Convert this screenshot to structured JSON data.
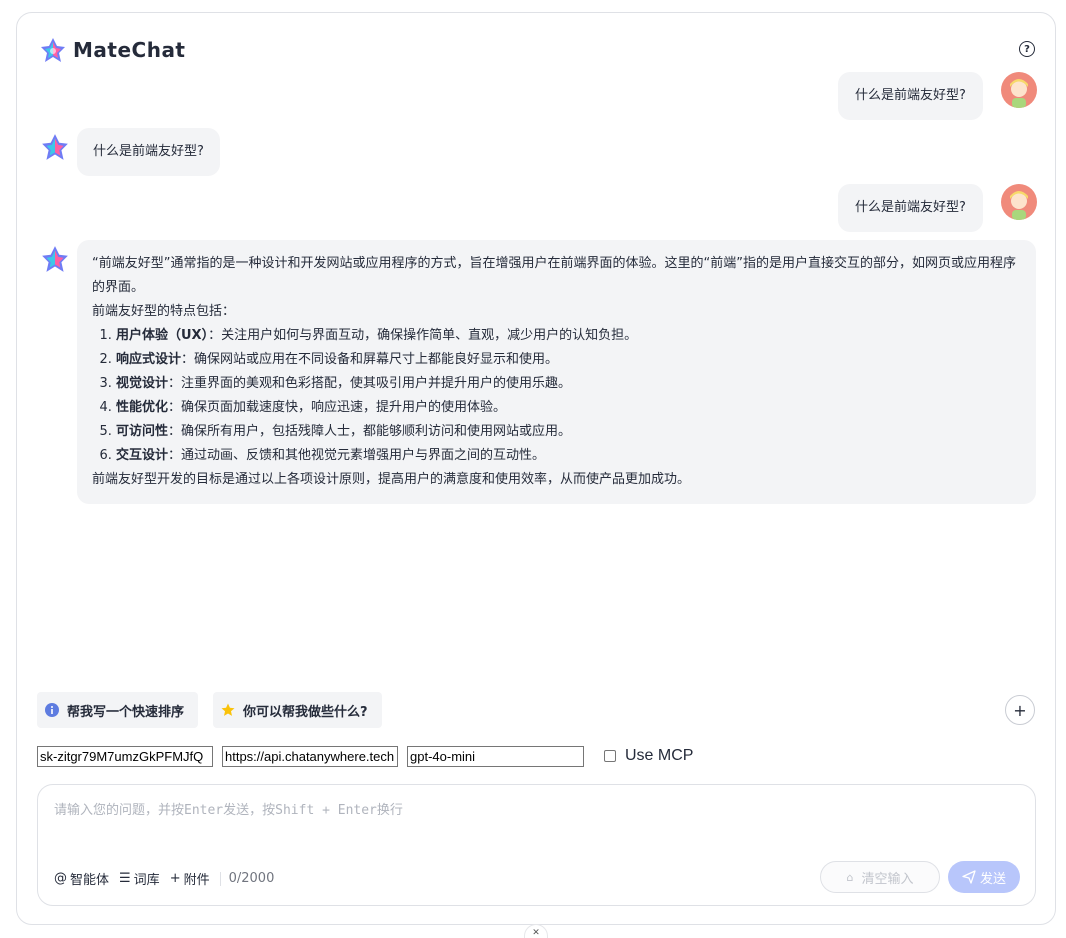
{
  "app": {
    "title": "MateChat",
    "help_icon": "help-icon"
  },
  "messages": [
    {
      "role": "user",
      "text": "什么是前端友好型?"
    },
    {
      "role": "assistant",
      "text": "什么是前端友好型?"
    },
    {
      "role": "user",
      "text": "什么是前端友好型?"
    },
    {
      "role": "assistant",
      "intro": "“前端友好型”通常指的是一种设计和开发网站或应用程序的方式，旨在增强用户在前端界面的体验。这里的“前端”指的是用户直接交互的部分，如网页或应用程序的界面。",
      "list_heading": "前端友好型的特点包括：",
      "points": [
        {
          "term": "用户体验（UX）",
          "desc": "：关注用户如何与界面互动，确保操作简单、直观，减少用户的认知负担。"
        },
        {
          "term": "响应式设计",
          "desc": "：确保网站或应用在不同设备和屏幕尺寸上都能良好显示和使用。"
        },
        {
          "term": "视觉设计",
          "desc": "：注重界面的美观和色彩搭配，使其吸引用户并提升用户的使用乐趣。"
        },
        {
          "term": "性能优化",
          "desc": "：确保页面加载速度快，响应迅速，提升用户的使用体验。"
        },
        {
          "term": "可访问性",
          "desc": "：确保所有用户，包括残障人士，都能够顺利访问和使用网站或应用。"
        },
        {
          "term": "交互设计",
          "desc": "：通过动画、反馈和其他视觉元素增强用户与界面之间的互动性。"
        }
      ],
      "conclusion": "前端友好型开发的目标是通过以上各项设计原则，提高用户的满意度和使用效率，从而使产品更加成功。"
    }
  ],
  "prompts": [
    {
      "label": "帮我写一个快速排序",
      "icon": "info-icon",
      "color": "#5e7ce0"
    },
    {
      "label": "你可以帮我做些什么?",
      "icon": "star-icon",
      "color": "#fac20a"
    }
  ],
  "config": {
    "api_key": "sk-zitgr79M7umzGkPFMJfQ",
    "base_url": "https://api.chatanywhere.tech",
    "model": "gpt-4o-mini",
    "mcp_label": "Use MCP",
    "mcp_checked": false
  },
  "input": {
    "placeholder": "请输入您的问题，并按Enter发送，按Shift + Enter换行",
    "agent_label": "智能体",
    "lexicon_label": "词库",
    "attach_label": "附件",
    "count": "0/2000",
    "clear_label": "清空输入",
    "send_label": "发送"
  },
  "colors": {
    "accent": "#5e7ce0",
    "send_disabled": "#b8c6fb",
    "bubble": "#f3f4f6",
    "avatar": "#f08a7b"
  }
}
